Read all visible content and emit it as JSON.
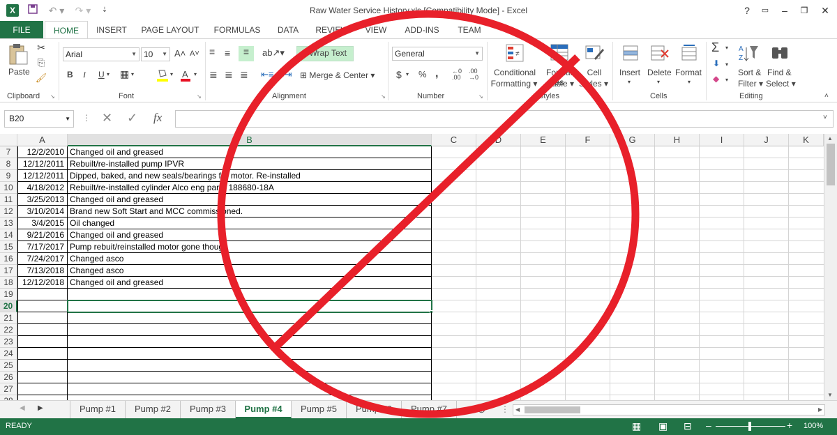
{
  "window": {
    "title": "Raw  Water Service History.xls  [Compatibility Mode] - Excel",
    "app_icon": "X"
  },
  "ribbon_tabs": [
    "FILE",
    "HOME",
    "INSERT",
    "PAGE LAYOUT",
    "FORMULAS",
    "DATA",
    "REVIEW",
    "VIEW",
    "ADD-INS",
    "TEAM"
  ],
  "ribbon": {
    "clipboard": {
      "paste": "Paste",
      "label": "Clipboard"
    },
    "font": {
      "name": "Arial",
      "size": "10",
      "label": "Font",
      "bold": "B",
      "italic": "I",
      "underline": "U"
    },
    "alignment": {
      "wrap_text": "Wrap Text",
      "merge_center": "Merge & Center",
      "label": "Alignment"
    },
    "number": {
      "format": "General",
      "currency": "$",
      "percent": "%",
      "comma": ",",
      "label": "Number"
    },
    "styles": {
      "conditional_1": "Conditional",
      "conditional_2": "Formatting",
      "format_table_1": "Format as",
      "format_table_2": "Table",
      "cell_styles_1": "Cell",
      "cell_styles_2": "Styles",
      "label": "Styles"
    },
    "cells": {
      "insert": "Insert",
      "delete": "Delete",
      "format": "Format",
      "label": "Cells"
    },
    "editing": {
      "sort_1": "Sort &",
      "sort_2": "Filter",
      "find_1": "Find &",
      "find_2": "Select",
      "label": "Editing"
    }
  },
  "formula_bar": {
    "name_box": "B20",
    "fx": "fx",
    "value": ""
  },
  "columns": [
    "A",
    "B",
    "C",
    "D",
    "E",
    "F",
    "G",
    "H",
    "I",
    "J",
    "K"
  ],
  "selected_cell": "B20",
  "rows": [
    {
      "num": "7",
      "date": "12/2/2010",
      "desc": "Changed oil and greased"
    },
    {
      "num": "8",
      "date": "12/12/2011",
      "desc": "Rebuilt/re-installed pump IPVR"
    },
    {
      "num": "9",
      "date": "12/12/2011",
      "desc": "Dipped, baked, and new seals/bearings for motor. Re-installed"
    },
    {
      "num": "10",
      "date": "4/18/2012",
      "desc": "Rebuilt/re-installed cylinder Alco eng part# 188680-18A"
    },
    {
      "num": "11",
      "date": "3/25/2013",
      "desc": "Changed oil and greased"
    },
    {
      "num": "12",
      "date": "3/10/2014",
      "desc": "Brand new Soft Start and MCC commissioned."
    },
    {
      "num": "13",
      "date": "3/4/2015",
      "desc": "Oil changed"
    },
    {
      "num": "14",
      "date": "9/21/2016",
      "desc": "Changed oil and greased"
    },
    {
      "num": "15",
      "date": "7/17/2017",
      "desc": "Pump rebuit/reinstalled motor gone though"
    },
    {
      "num": "16",
      "date": "7/24/2017",
      "desc": "Changed asco"
    },
    {
      "num": "17",
      "date": "7/13/2018",
      "desc": "Changed asco"
    },
    {
      "num": "18",
      "date": "12/12/2018",
      "desc": "Changed oil and greased"
    },
    {
      "num": "19",
      "date": "",
      "desc": ""
    },
    {
      "num": "20",
      "date": "",
      "desc": ""
    },
    {
      "num": "21",
      "date": "",
      "desc": ""
    },
    {
      "num": "22",
      "date": "",
      "desc": ""
    },
    {
      "num": "23",
      "date": "",
      "desc": ""
    },
    {
      "num": "24",
      "date": "",
      "desc": ""
    },
    {
      "num": "25",
      "date": "",
      "desc": ""
    },
    {
      "num": "26",
      "date": "",
      "desc": ""
    },
    {
      "num": "27",
      "date": "",
      "desc": ""
    },
    {
      "num": "28",
      "date": "",
      "desc": ""
    }
  ],
  "sheet_tabs": [
    "Pump #1",
    "Pump #2",
    "Pump #3",
    "Pump #4",
    "Pump #5",
    "Pump #6",
    "Pump #7"
  ],
  "active_sheet": "Pump #4",
  "status": {
    "mode": "READY",
    "zoom": "100%"
  },
  "overlay": {
    "symbol": "prohibition-sign",
    "color": "#e8202a"
  }
}
